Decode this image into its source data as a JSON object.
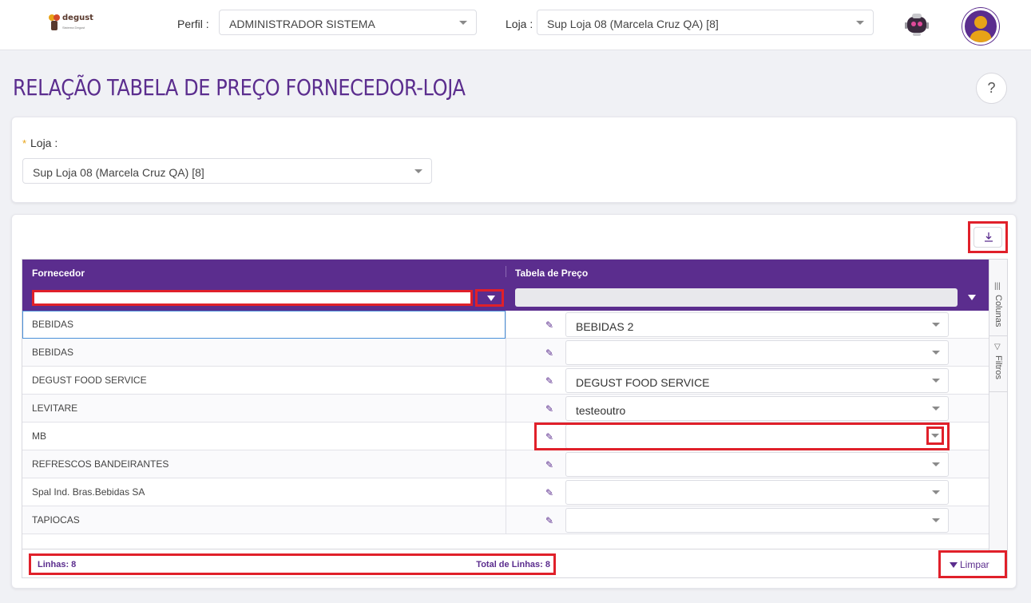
{
  "header": {
    "logo_text": "degust",
    "logo_sub": "Sistema Degust",
    "perfil_label": "Perfil :",
    "perfil_value": "ADMINISTRADOR SISTEMA",
    "loja_label": "Loja :",
    "loja_value": "Sup Loja 08 (Marcela Cruz QA) [8]"
  },
  "page": {
    "title": "RELAÇÃO TABELA DE PREÇO FORNECEDOR-LOJA",
    "help": "?"
  },
  "filter": {
    "required_mark": "*",
    "loja_label": "Loja :",
    "loja_value": "Sup Loja 08 (Marcela Cruz QA) [8]"
  },
  "grid": {
    "columns": [
      "Fornecedor",
      "Tabela de Preço"
    ],
    "side_tabs": [
      "Colunas",
      "Filtros"
    ],
    "rows": [
      {
        "fornecedor": "BEBIDAS",
        "tabela": "BEBIDAS 2"
      },
      {
        "fornecedor": "BEBIDAS",
        "tabela": ""
      },
      {
        "fornecedor": "DEGUST FOOD SERVICE",
        "tabela": "DEGUST FOOD SERVICE"
      },
      {
        "fornecedor": "LEVITARE",
        "tabela": "testeoutro"
      },
      {
        "fornecedor": "MB",
        "tabela": ""
      },
      {
        "fornecedor": "REFRESCOS BANDEIRANTES",
        "tabela": ""
      },
      {
        "fornecedor": "Spal Ind. Bras.Bebidas SA",
        "tabela": ""
      },
      {
        "fornecedor": "TAPIOCAS",
        "tabela": ""
      }
    ],
    "footer": {
      "lines": "Linhas: 8",
      "total": "Total de Linhas: 8"
    },
    "clear_label": "Limpar"
  },
  "colors": {
    "primary": "#5b2d8e",
    "highlight": "#e0202a",
    "required": "#e8a317"
  }
}
